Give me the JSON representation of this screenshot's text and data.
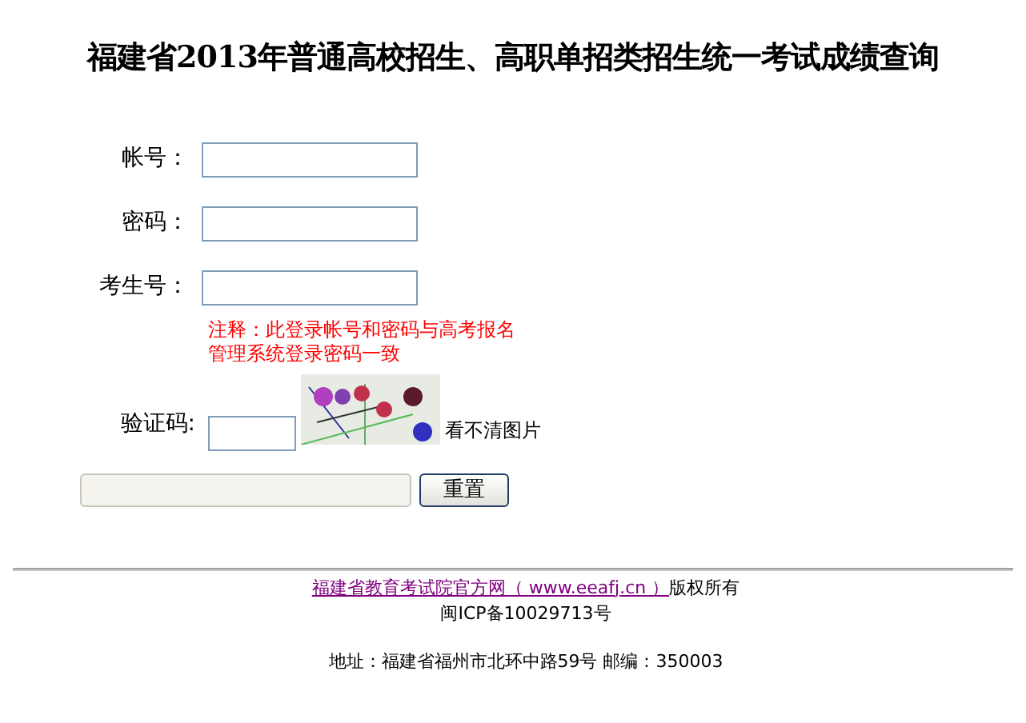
{
  "title": "福建省2013年普通高校招生、高职单招类招生统一考试成绩查询",
  "fields": [
    {
      "label": "帐号："
    },
    {
      "label": "密码："
    },
    {
      "label": "考生号："
    }
  ],
  "note": [
    "注释：此登录帐号和密码与高考报名",
    "管理系统登录密码一致"
  ],
  "captcha": {
    "label": "验证码:",
    "refresh_link": "看不清图片"
  },
  "buttons": {
    "reset": "重置"
  },
  "footer": {
    "link": "福建省教育考试院官方网（ www.eeafj.cn ）",
    "rights": "版权所有",
    "icp": "闽ICP备10029713号",
    "address": "地址：福建省福州市北环中路59号 邮编：350003"
  }
}
